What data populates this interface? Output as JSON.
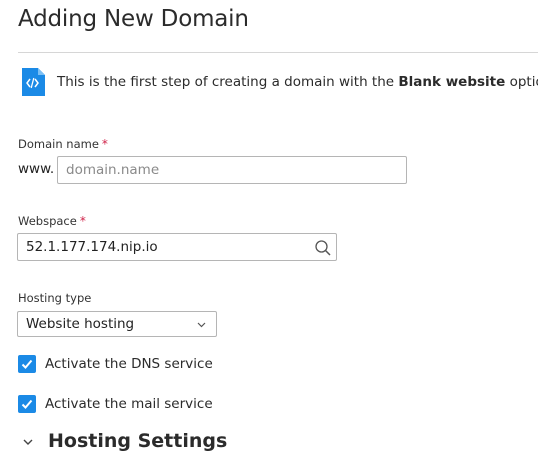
{
  "page": {
    "title": "Adding New Domain"
  },
  "info": {
    "text_prefix": "This is the first step of creating a domain with the ",
    "text_bold": "Blank website",
    "text_suffix": " option.",
    "icon": "code-file-icon",
    "icon_color": "#1b8ae6"
  },
  "domain": {
    "label": "Domain name",
    "required_mark": "*",
    "prefix": "www.",
    "placeholder": "domain.name",
    "value": ""
  },
  "webspace": {
    "label": "Webspace",
    "required_mark": "*",
    "value": "52.1.177.174.nip.io",
    "icon": "search-icon"
  },
  "hosting_type": {
    "label": "Hosting type",
    "selected": "Website hosting",
    "icon": "chevron-down-icon"
  },
  "options": {
    "dns": {
      "label": "Activate the DNS service",
      "checked": true
    },
    "mail": {
      "label": "Activate the mail service",
      "checked": true
    }
  },
  "section": {
    "title": "Hosting Settings",
    "icon": "chevron-down-icon"
  },
  "colors": {
    "accent": "#1b8ae6",
    "required": "#d0244a",
    "border": "#b5b5b5"
  }
}
